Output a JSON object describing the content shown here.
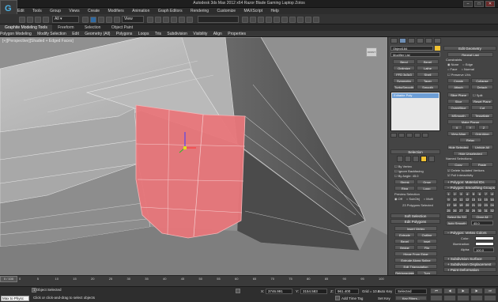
{
  "titlebar": {
    "title": "Autodesk 3ds Max 2012 x64    Razor Blade Gaming Laptop Zotos",
    "app_icon": "3ds"
  },
  "menubar": [
    "Edit",
    "Tools",
    "Group",
    "Views",
    "Create",
    "Modifiers",
    "Animation",
    "Graph Editors",
    "Rendering",
    "Customize",
    "MAXScript",
    "Help"
  ],
  "toolbar": {
    "view_dropdown": "View",
    "selection_set": ""
  },
  "ribbon_tabs": [
    "Graphite Modeling Tools",
    "Freeform",
    "Selection",
    "Object Paint"
  ],
  "ribbon": [
    "Polygon Modeling",
    "Modify Selection",
    "Edit",
    "Geometry (All)",
    "Polygons",
    "Loops",
    "Tris",
    "Subdivision",
    "Visibility",
    "Align",
    "Properties"
  ],
  "viewport": {
    "label": "[+][Perspective][Shaded + Edged Faces]",
    "cube": "FRONT"
  },
  "panel": {
    "object_name": "Object184",
    "modifier_list": "Modifier List",
    "modifiers": [
      [
        "Bend",
        "Bevel"
      ],
      [
        "Optimize",
        "Lathe"
      ],
      [
        "FFD 3x3x3",
        "Shell"
      ],
      [
        "Symmetry",
        "Taper"
      ],
      [
        "TurboSmooth",
        "Smooth"
      ]
    ],
    "stack_item": "Editable Poly",
    "selection_title": "Selection",
    "checks": [
      "By Vertex",
      "Ignore Backfacing",
      "By Angle: 45.0",
      "Shrink",
      "Grow",
      "Ring",
      "Loop"
    ],
    "preview": "Preview Selection",
    "preview_opts": [
      "Off",
      "SubObj",
      "Multi"
    ],
    "sel_count": "23 Polygons Selected",
    "soft_sel": "Soft Selection",
    "edit_polys": "Edit Polygons",
    "insert_vertex": "Insert Vertex",
    "edit_rows": [
      [
        "Extrude",
        "Outline"
      ],
      [
        "Bevel",
        "Inset"
      ],
      [
        "Bridge",
        "Flip"
      ]
    ],
    "hinge": "Hinge From Edge",
    "extrude_spline": "Extrude Along Spline",
    "edit_tri": "Edit Triangulation",
    "retri": [
      "Retriangulate",
      "Turn"
    ],
    "edit_geo_title": "Edit Geometry",
    "repeat_last": "Repeat Last",
    "constraints": "Constraints",
    "cons_opts": [
      "None",
      "Edge",
      "Face",
      "Normal"
    ],
    "preserve_uvs": "Preserve UVs",
    "geo_rows": [
      [
        "Create",
        "Collapse"
      ],
      [
        "Attach",
        "Detach"
      ]
    ],
    "slice_plane": "Slice Plane",
    "split": "Split",
    "slice_rows": [
      [
        "Slice",
        "Reset Plane"
      ],
      [
        "QuickSlice",
        "Cut"
      ]
    ],
    "msmooth": [
      "MSmooth",
      "Tessellate"
    ],
    "make_planar": "Make Planar",
    "xyz": [
      "X",
      "Y",
      "Z"
    ],
    "view_align": [
      "View Align",
      "Grid Align"
    ],
    "relax": "Relax",
    "hide_rows": [
      [
        "Hide Selected",
        "Unhide All"
      ]
    ],
    "hide_unsel": "Hide Unselected",
    "named_sel": "Named Selections:",
    "copy_paste": [
      "Copy",
      "Paste"
    ],
    "delete_iso": "Delete Isolated Vertices",
    "full_inter": "Full Interactivity",
    "poly_mat": "Polygon: Material IDs",
    "smooth_groups": "Polygon: Smoothing Groups",
    "sg_numbers": [
      "1",
      "2",
      "3",
      "4",
      "5",
      "6",
      "7",
      "8",
      "9",
      "10",
      "11",
      "12",
      "13",
      "14",
      "15",
      "16",
      "17",
      "18",
      "19",
      "20",
      "21",
      "22",
      "23",
      "24",
      "25",
      "26",
      "27",
      "28",
      "29",
      "30",
      "31",
      "32"
    ],
    "select_by_sg": "Select By SG",
    "clear_all": "Clear All",
    "auto_smooth": "Auto Smooth",
    "auto_smooth_val": "45.0",
    "vertex_colors": "Polygon: Vertex Colors",
    "color_lbl": "Color:",
    "illum_lbl": "Illumination:",
    "alpha_lbl": "Alpha:",
    "alpha_val": "100.0",
    "subdiv_surface": "Subdivision Surface",
    "subdiv_disp": "Subdivision Displacement",
    "paint_deform": "Paint Deformation"
  },
  "timeline": {
    "slider": "0 / 100",
    "ticks": [
      "0",
      "5",
      "10",
      "15",
      "20",
      "25",
      "30",
      "35",
      "40",
      "45",
      "50",
      "55",
      "60",
      "65",
      "70",
      "75",
      "80",
      "85",
      "90",
      "95",
      "100"
    ]
  },
  "status": {
    "maxscript": "Max to Physc",
    "selected": "1 Object Selected",
    "prompt": "Click or click-and-drag to select objects",
    "x_lbl": "X:",
    "x_val": "3746.991",
    "y_lbl": "Y:",
    "y_val": "3154.583",
    "z_lbl": "Z:",
    "z_val": "961.400",
    "grid": "Grid = 10.0",
    "auto_key": "Auto Key",
    "set_key": "Set Key",
    "selected_dd": "Selected",
    "key_filters": "Key Filters...",
    "add_time_tag": "Add Time Tag"
  },
  "colors": {
    "selection": "#e8767a",
    "viewport_bg": "#8f8f8f",
    "highlight": "#f1c232"
  }
}
